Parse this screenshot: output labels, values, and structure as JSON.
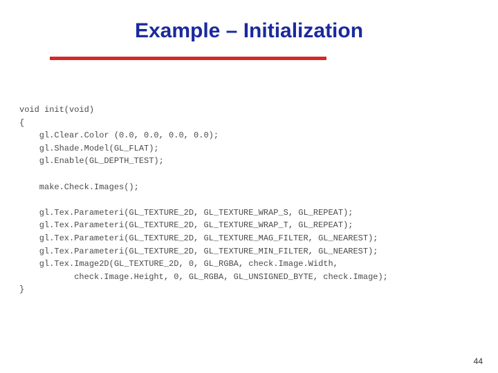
{
  "title": "Example – Initialization",
  "page_number": "44",
  "code": "void init(void)\n{\n    gl.Clear.Color (0.0, 0.0, 0.0, 0.0);\n    gl.Shade.Model(GL_FLAT);\n    gl.Enable(GL_DEPTH_TEST);\n\n    make.Check.Images();\n\n    gl.Tex.Parameteri(GL_TEXTURE_2D, GL_TEXTURE_WRAP_S, GL_REPEAT);\n    gl.Tex.Parameteri(GL_TEXTURE_2D, GL_TEXTURE_WRAP_T, GL_REPEAT);\n    gl.Tex.Parameteri(GL_TEXTURE_2D, GL_TEXTURE_MAG_FILTER, GL_NEAREST);\n    gl.Tex.Parameteri(GL_TEXTURE_2D, GL_TEXTURE_MIN_FILTER, GL_NEAREST);\n    gl.Tex.Image2D(GL_TEXTURE_2D, 0, GL_RGBA, check.Image.Width,\n           check.Image.Height, 0, GL_RGBA, GL_UNSIGNED_BYTE, check.Image);\n}"
}
